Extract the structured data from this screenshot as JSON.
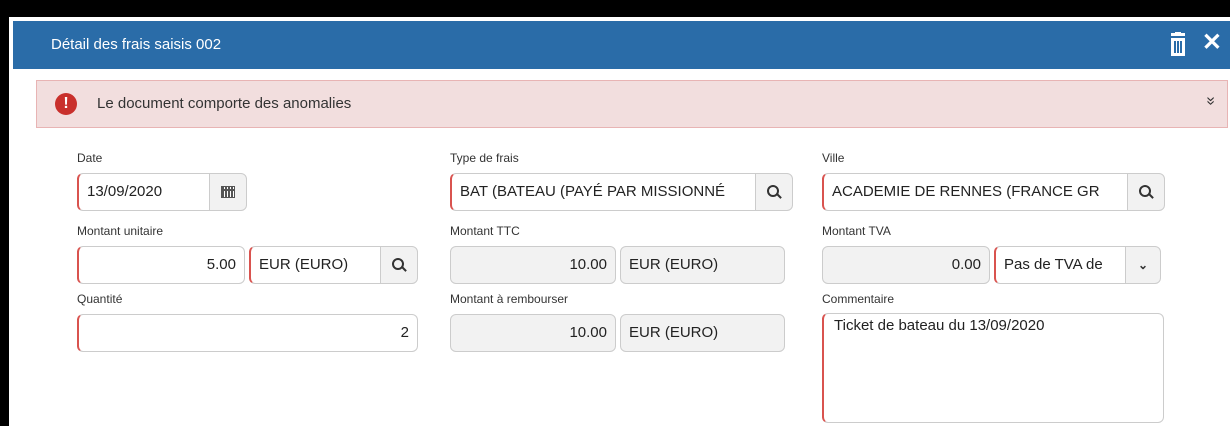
{
  "header": {
    "title": "Détail des frais saisis 002",
    "close_glyph": "✕"
  },
  "alert": {
    "message": "Le document comporte des anomalies",
    "icon_glyph": "!",
    "expand_glyph": "»"
  },
  "fields": {
    "date": {
      "label": "Date",
      "value": "13/09/2020"
    },
    "type_frais": {
      "label": "Type de frais",
      "value": "BAT (BATEAU (PAYÉ PAR MISSIONNÉ"
    },
    "ville": {
      "label": "Ville",
      "value": "ACADEMIE DE RENNES (FRANCE GR"
    },
    "montant_unitaire": {
      "label": "Montant unitaire",
      "value": "5.00",
      "currency": "EUR (EURO)"
    },
    "montant_ttc": {
      "label": "Montant TTC",
      "value": "10.00",
      "currency": "EUR (EURO)"
    },
    "montant_tva": {
      "label": "Montant TVA",
      "value": "0.00",
      "tva_option": "Pas de TVA de"
    },
    "quantite": {
      "label": "Quantité",
      "value": "2"
    },
    "montant_rembourser": {
      "label": "Montant à rembourser",
      "value": "10.00",
      "currency": "EUR (EURO)"
    },
    "commentaire": {
      "label": "Commentaire",
      "value": "Ticket de bateau du 13/09/2020"
    }
  },
  "colors": {
    "header_bg": "#2a6ca8",
    "alert_bg": "#f2dede",
    "alert_icon": "#c9302c",
    "required_border": "#d9534f"
  }
}
